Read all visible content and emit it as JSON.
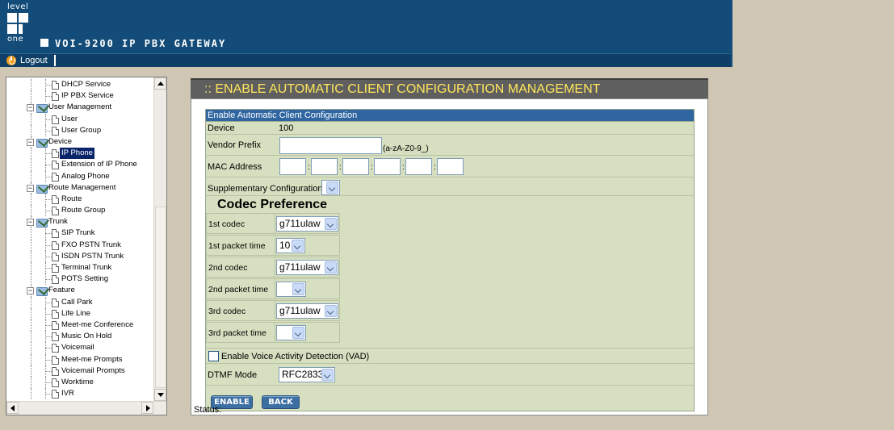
{
  "header": {
    "logo_top": "level",
    "logo_bottom": "one",
    "title": "VOI-9200 IP PBX GATEWAY",
    "logout_label": "Logout"
  },
  "tree": [
    {
      "label": "DHCP Service",
      "type": "leaf"
    },
    {
      "label": "IP PBX Service",
      "type": "leaf"
    },
    {
      "label": "User Management",
      "type": "folder",
      "expander": "−"
    },
    {
      "label": "User",
      "type": "leaf"
    },
    {
      "label": "User Group",
      "type": "leaf"
    },
    {
      "label": "Device",
      "type": "folder",
      "expander": "−"
    },
    {
      "label": "IP Phone",
      "type": "leaf",
      "selected": true
    },
    {
      "label": "Extension of IP Phone",
      "type": "leaf"
    },
    {
      "label": "Analog Phone",
      "type": "leaf"
    },
    {
      "label": "Route Management",
      "type": "folder",
      "expander": "−"
    },
    {
      "label": "Route",
      "type": "leaf"
    },
    {
      "label": "Route Group",
      "type": "leaf"
    },
    {
      "label": "Trunk",
      "type": "folder",
      "expander": "−"
    },
    {
      "label": "SIP Trunk",
      "type": "leaf"
    },
    {
      "label": "FXO PSTN Trunk",
      "type": "leaf"
    },
    {
      "label": "ISDN PSTN Trunk",
      "type": "leaf"
    },
    {
      "label": "Terminal Trunk",
      "type": "leaf"
    },
    {
      "label": "POTS Setting",
      "type": "leaf"
    },
    {
      "label": "Feature",
      "type": "folder",
      "expander": "−"
    },
    {
      "label": "Call Park",
      "type": "leaf"
    },
    {
      "label": "Life Line",
      "type": "leaf"
    },
    {
      "label": "Meet-me Conference",
      "type": "leaf"
    },
    {
      "label": "Music On Hold",
      "type": "leaf"
    },
    {
      "label": "Voicemail",
      "type": "leaf"
    },
    {
      "label": "Meet-me Prompts",
      "type": "leaf"
    },
    {
      "label": "Voicemail Prompts",
      "type": "leaf"
    },
    {
      "label": "Worktime",
      "type": "leaf"
    },
    {
      "label": "IVR",
      "type": "leaf"
    }
  ],
  "main": {
    "title": ":: ENABLE AUTOMATIC CLIENT CONFIGURATION MANAGEMENT",
    "form_header": "Enable Automatic Client Configuration",
    "device_label": "Device",
    "device_value": "100",
    "vendor_prefix_label": "Vendor Prefix",
    "vendor_prefix_value": "",
    "vendor_prefix_hint": "(a-zA-Z0-9_)",
    "mac_label": "MAC Address",
    "mac_sep": ":",
    "supplementary_label": "Supplementary Configuration",
    "supplementary_value": "",
    "codec_title": "Codec Preference",
    "codec_rows": [
      {
        "label": "1st codec",
        "value": "g711ulaw"
      },
      {
        "label": "1st packet time",
        "value": "10"
      },
      {
        "label": "2nd codec",
        "value": "g711ulaw"
      },
      {
        "label": "2nd packet time",
        "value": ""
      },
      {
        "label": "3rd codec",
        "value": "g711ulaw"
      },
      {
        "label": "3rd packet time",
        "value": ""
      }
    ],
    "vad_label": "Enable Voice Activity Detection (VAD)",
    "vad_checked": false,
    "dtmf_label": "DTMF Mode",
    "dtmf_value": "RFC2833",
    "enable_button": "ENABLE",
    "back_button": "BACK",
    "status_label": "Status:"
  }
}
